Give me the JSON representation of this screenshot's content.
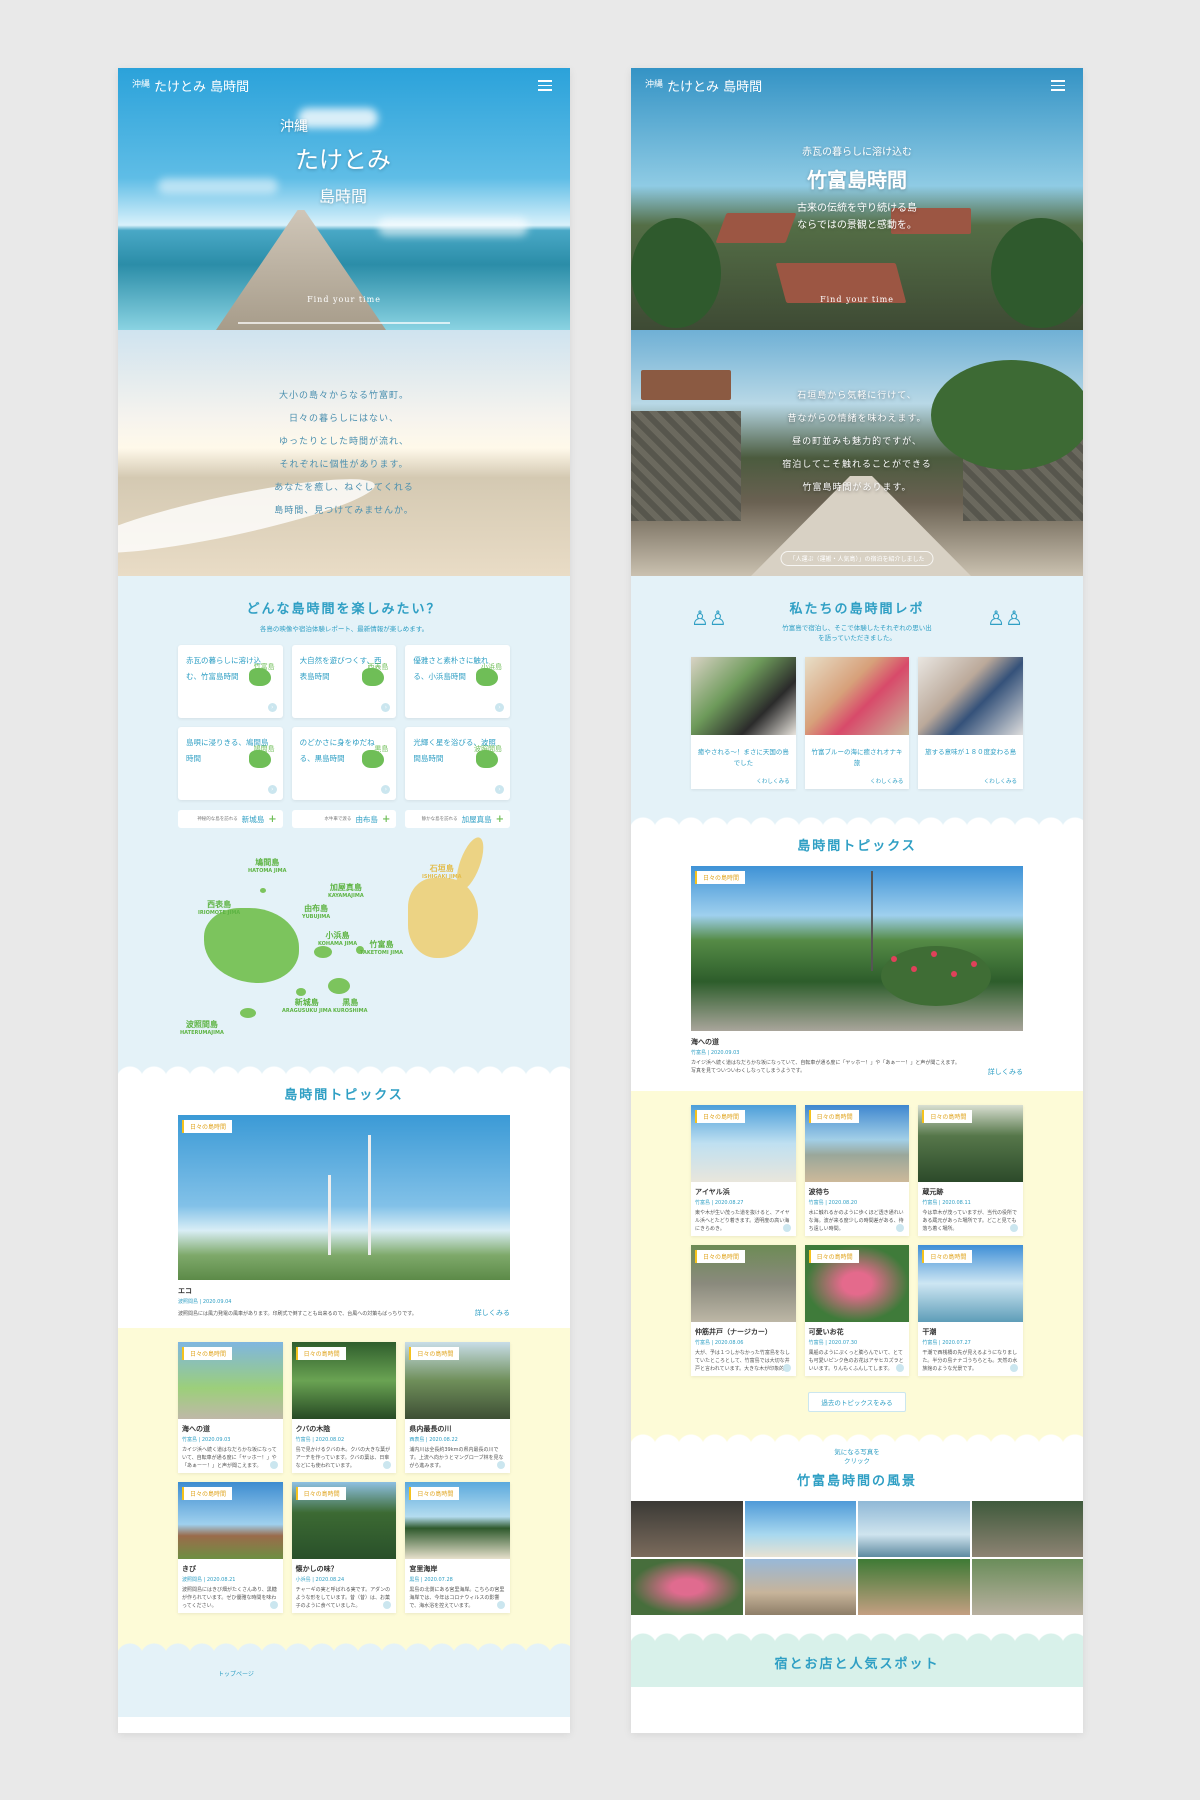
{
  "left": {
    "logo": {
      "small": "沖縄",
      "name": "たけとみ 島時間"
    },
    "hero": {
      "title_1": "沖縄",
      "title_2": "たけとみ",
      "title_3": "島時間",
      "tagline": "Find your time"
    },
    "intro": {
      "lines": [
        "大小の島々からなる竹富町。",
        "日々の暮らしにはない、",
        "ゆったりとした時間が流れ、",
        "それぞれに個性があります。",
        "あなたを癒し、ねぐしてくれる",
        "島時間、見つけてみませんか。"
      ]
    },
    "choose": {
      "title": "どんな島時間を楽しみたい？",
      "subtitle": "各島の映像や宿泊体験レポート、最新情報が楽しめます。",
      "cards": [
        {
          "text": "赤瓦の暮らしに溶け込む、竹富島時間",
          "island": "竹富島"
        },
        {
          "text": "大自然を遊びつくす、西表島時間",
          "island": "西表島"
        },
        {
          "text": "優雅さと素朴さに触れる、小浜島時間",
          "island": "小浜島"
        },
        {
          "text": "島唄に浸りきる、鳩間島時間",
          "island": "鳩間島"
        },
        {
          "text": "のどかさに身をゆだねる、黒島時間",
          "island": "黒島"
        },
        {
          "text": "光輝く星を浴びる、波照間島時間",
          "island": "波照間島"
        }
      ],
      "pills": [
        {
          "small": "神秘的な島を訪れる",
          "name": "新城島"
        },
        {
          "small": "水牛車で渡る",
          "name": "由布島"
        },
        {
          "small": "静かな島を訪れる",
          "name": "加屋真島"
        }
      ]
    },
    "map": {
      "labels": [
        {
          "jp": "鳩間島",
          "en": "HATOMA JIMA"
        },
        {
          "jp": "加屋真島",
          "en": "KAYAMAJIMA"
        },
        {
          "jp": "石垣島",
          "en": "ISHIGAKI JIMA"
        },
        {
          "jp": "西表島",
          "en": "IRIOMOTE JIMA"
        },
        {
          "jp": "由布島",
          "en": "YUBUJIMA"
        },
        {
          "jp": "小浜島",
          "en": "KOHAMA JIMA"
        },
        {
          "jp": "竹富島",
          "en": "TAKETOMI JIMA"
        },
        {
          "jp": "新城島",
          "en": "ARAGUSUKU JIMA"
        },
        {
          "jp": "黒島",
          "en": "KUROSHIMA"
        },
        {
          "jp": "波照間島",
          "en": "HATERUMAJIMA"
        }
      ]
    },
    "topics": {
      "title": "島時間トピックス",
      "main": {
        "tag": "日々の島時間",
        "title": "エコ",
        "date": "波照間島 | 2020.09.04",
        "excerpt": "波照間島には風力発電の風車があります。印刷式で倒すことも出来るので、台風への対策もばっちりです。",
        "more": "詳しくみる"
      },
      "cards": [
        {
          "tag": "日々の島時間",
          "title": "海への道",
          "date": "竹富島 | 2020.09.03",
          "excerpt": "カイジ浜へ続く道はなだらかな坂になっていて、自転車が通る度に「ヤッホー！」や「あぁーー！」と声が聞こえます。"
        },
        {
          "tag": "日々の島時間",
          "title": "クバの木陰",
          "date": "竹富島 | 2020.08.02",
          "excerpt": "島で見かけるクバの木。クバの大きな葉がアーチを作っています。クバの葉は、日傘などにも使われています。"
        },
        {
          "tag": "日々の島時間",
          "title": "県内最長の川",
          "date": "西表島 | 2020.08.22",
          "excerpt": "浦内川は全長約39kmの県内最長の川です。上流へ向かうとマングローブ林を見ながら進みます。"
        },
        {
          "tag": "日々の島時間",
          "title": "きび",
          "date": "波照間島 | 2020.08.21",
          "excerpt": "波照間島にはきび畑がたくさんあり、黒糖が作られています。ゼひ優雅な時間を味わってください。"
        },
        {
          "tag": "日々の島時間",
          "title": "懐かしの味？",
          "date": "小浜島 | 2020.08.24",
          "excerpt": "チャーギの実と呼ばれる実です。アダンのような形をしています。昔（昔）は、お菓子のように食べていました。"
        },
        {
          "tag": "日々の島時間",
          "title": "宮里海岸",
          "date": "黒島 | 2020.07.28",
          "excerpt": "黒島の北側にある宮里海岸。こちらの宮里海岸では、今年はコロナウィルスの影響で、海水浴を控えています。"
        }
      ],
      "footer": "トップページ"
    }
  },
  "right": {
    "logo": {
      "small": "沖縄",
      "name": "たけとみ 島時間"
    },
    "hero": {
      "pre": "赤瓦の暮らしに溶け込む",
      "title": "竹富島時間",
      "line1": "古来の伝統を守り続ける島",
      "line2": "ならではの景観と感動を。",
      "tagline": "Find your time"
    },
    "intro": {
      "lines": [
        "石垣島から気軽に行けて、",
        "昔ながらの情緒を味わえます。",
        "昼の町並みも魅力的ですが、",
        "宿泊してこそ触れることができる",
        "竹富島時間があります。"
      ],
      "credit": "「人運ぶ（運搬・人気島）」の宿泊を紹介しました"
    },
    "report": {
      "title": "私たちの島時間レポ",
      "subtitle": "竹富島で宿泊し、そこで体験したそれぞれの思い出を語っていただきました。",
      "cards": [
        {
          "caption": "癒やされる〜！まさに天国の島でした",
          "more": "くわしくみる"
        },
        {
          "caption": "竹富ブルーの海に癒されオナキ旅",
          "more": "くわしくみる"
        },
        {
          "caption": "旅する意味が１８０度変わる島",
          "more": "くわしくみる"
        }
      ]
    },
    "topics": {
      "title": "島時間トピックス",
      "main": {
        "tag": "日々の島時間",
        "title": "海への道",
        "date": "竹富島 | 2020.09.03",
        "excerpt": "カイジ浜へ続く道はなだらかな坂になっていて、自転車が通る度に「ヤッホー！」や「あぁーー！」と声が聞こえます。写真を見てついついわくしなってしまうようです。",
        "more": "詳しくみる"
      },
      "cards": [
        {
          "tag": "日々の島時間",
          "title": "アイヤル浜",
          "date": "竹富島 | 2020.08.27",
          "excerpt": "東や木が生い茂った道を抜けると、アイヤル浜へとたどり着きます。透明度の高い海にきらめき。"
        },
        {
          "tag": "日々の島時間",
          "title": "波待ち",
          "date": "竹富島 | 2020.08.20",
          "excerpt": "水に触れるかのように歩くほど透き通れいな海。波が来る度少しの時間差がある、待ち遠しい時間。"
        },
        {
          "tag": "日々の島時間",
          "title": "蔵元跡",
          "date": "竹富島 | 2020.08.11",
          "excerpt": "今は草木が茂っていますが、当代の役所である蔵元があった場所です。どこと見ても落ち着く場所。"
        },
        {
          "tag": "日々の島時間",
          "title": "仲筋井戸（ナージカー）",
          "date": "竹富島 | 2020.08.06",
          "excerpt": "大が、予は１つしかなかった竹富島をなしていたところとして、竹富島では大切な井戸と言われています。大きな木が印象的。"
        },
        {
          "tag": "日々の島時間",
          "title": "可愛いお花",
          "date": "竹富島 | 2020.07.30",
          "excerpt": "風船のようにぷくっと膨らんでいて、とても可愛いピンク色のお花はアサヒカズラといいます。りんもくふんしてします。"
        },
        {
          "tag": "日々の島時間",
          "title": "干潮",
          "date": "竹富島 | 2020.07.27",
          "excerpt": "干潮で西桟橋の先が見えるようになりました。半分の島ナナゴうちらとも。天然の水族館のような光景です。"
        }
      ],
      "past": "過去のトピックスをみる"
    },
    "landscape": {
      "badge_1": "気になる写真を",
      "badge_2": "クリック",
      "title": "竹富島時間の風景"
    },
    "next": {
      "title": "宿とお店と人気スポット"
    }
  }
}
